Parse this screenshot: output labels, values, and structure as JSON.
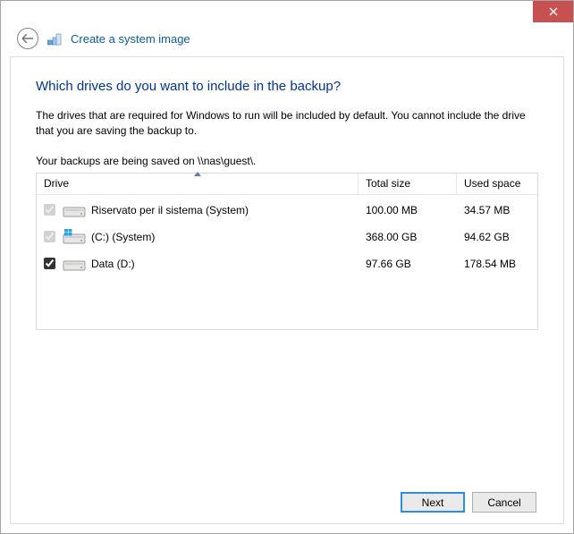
{
  "titlebar": {
    "close_tooltip": "Close"
  },
  "header": {
    "title": "Create a system image"
  },
  "main": {
    "heading": "Which drives do you want to include in the backup?",
    "description": "The drives that are required for Windows to run will be included by default. You cannot include the drive that you are saving the backup to.",
    "save_path_text": "Your backups are being saved on \\\\nas\\guest\\."
  },
  "table": {
    "columns": {
      "drive": "Drive",
      "total": "Total size",
      "used": "Used space"
    },
    "sort_column": "drive",
    "rows": [
      {
        "checked": true,
        "disabled": true,
        "icon": "drive",
        "label": "Riservato per il sistema (System)",
        "total": "100.00 MB",
        "used": "34.57 MB"
      },
      {
        "checked": true,
        "disabled": true,
        "icon": "drive-win",
        "label": "(C:) (System)",
        "total": "368.00 GB",
        "used": "94.62 GB"
      },
      {
        "checked": true,
        "disabled": false,
        "icon": "drive",
        "label": "Data (D:)",
        "total": "97.66 GB",
        "used": "178.54 MB"
      }
    ]
  },
  "footer": {
    "next": "Next",
    "cancel": "Cancel"
  }
}
